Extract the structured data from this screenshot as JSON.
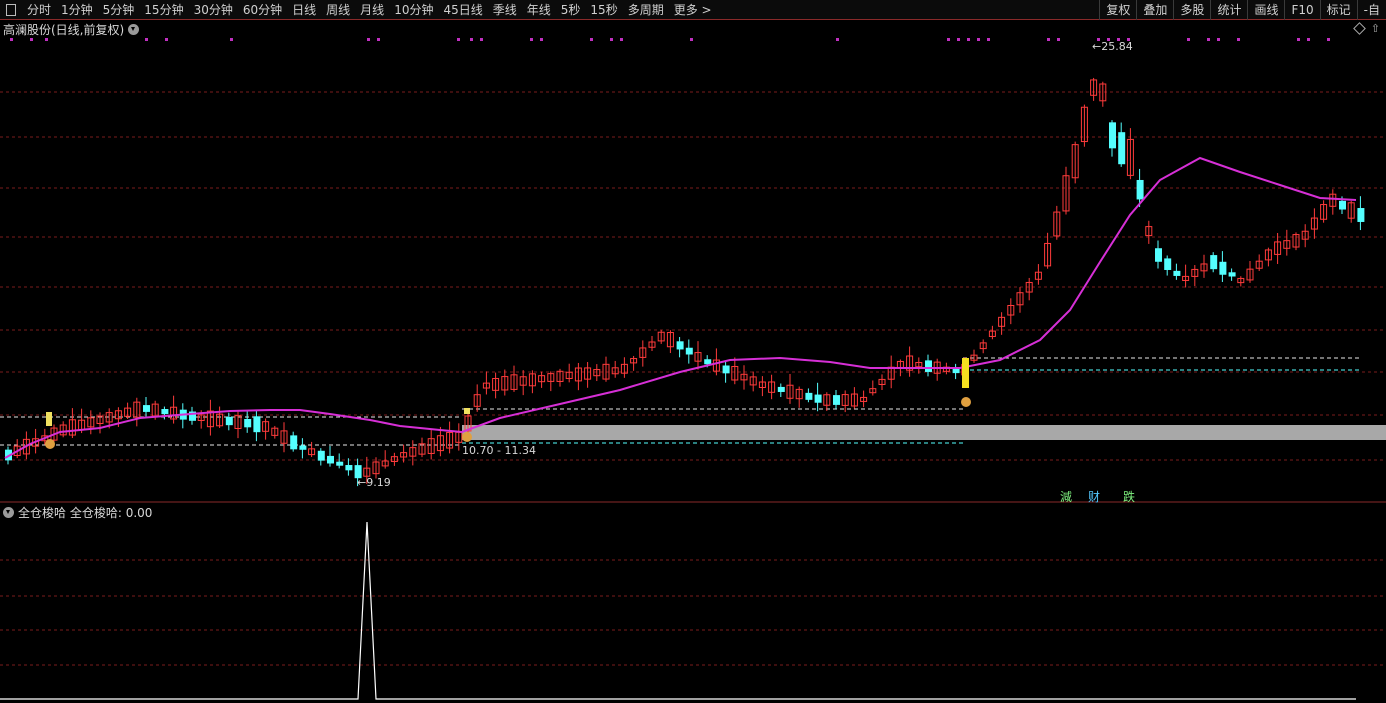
{
  "toolbar": {
    "tabs": [
      "分时",
      "1分钟",
      "5分钟",
      "15分钟",
      "30分钟",
      "60分钟",
      "日线",
      "周线",
      "月线",
      "10分钟",
      "45日线",
      "季线",
      "年线",
      "5秒",
      "15秒",
      "多周期",
      "更多 >"
    ],
    "tools": [
      "复权",
      "叠加",
      "多股",
      "统计",
      "画线",
      "F10",
      "标记",
      "-自"
    ]
  },
  "stock": {
    "title": "高澜股份(日线,前复权)"
  },
  "labels": {
    "high": "←25.84",
    "low": "←9.19",
    "range": "10.70 - 11.34"
  },
  "signals": {
    "s1": "減",
    "s2": "财",
    "s3": "跌"
  },
  "indicator": {
    "name": "全仓梭哈",
    "value_text": "全仓梭哈: 0.00"
  },
  "colors": {
    "up": "#ff3b3b",
    "down": "#54ffff",
    "ma": "#d62fd6",
    "grid": "#7a1b1b",
    "band": "#a8a8a8"
  }
}
